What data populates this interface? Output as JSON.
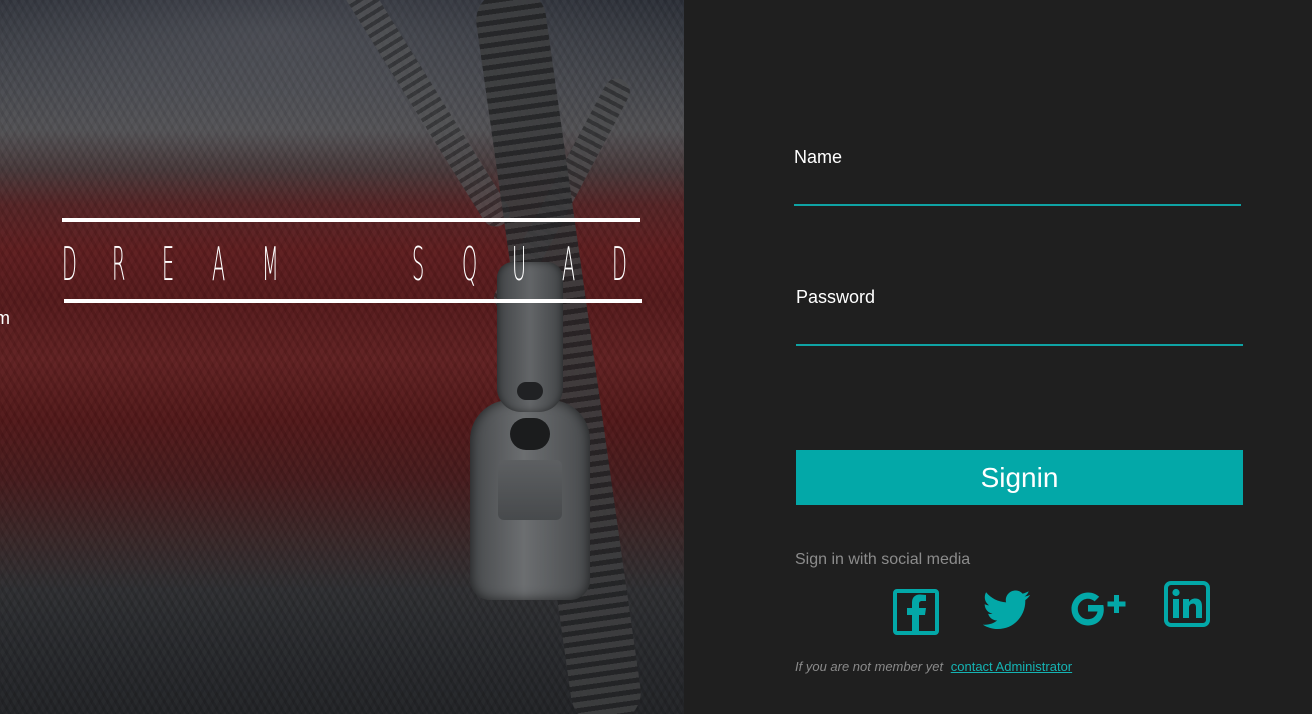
{
  "hero": {
    "brand_letters": [
      "D",
      "R",
      "E",
      "A",
      "M",
      "",
      "S",
      "Q",
      "U",
      "A",
      "D"
    ],
    "tagline": "we design your dream"
  },
  "login": {
    "name_label": "Name",
    "name_value": "",
    "password_label": "Password",
    "password_value": "",
    "signin_label": "Signin",
    "social_label": "Sign in with social media",
    "social_icons": [
      "facebook-icon",
      "twitter-icon",
      "google-plus-icon",
      "linkedin-icon"
    ],
    "footer_text": "If you are not member yet",
    "footer_link": "contact Administrator"
  },
  "colors": {
    "accent": "#03a8a8",
    "panel_bg": "#1f1f1f",
    "muted_text": "#8c8c8c"
  }
}
